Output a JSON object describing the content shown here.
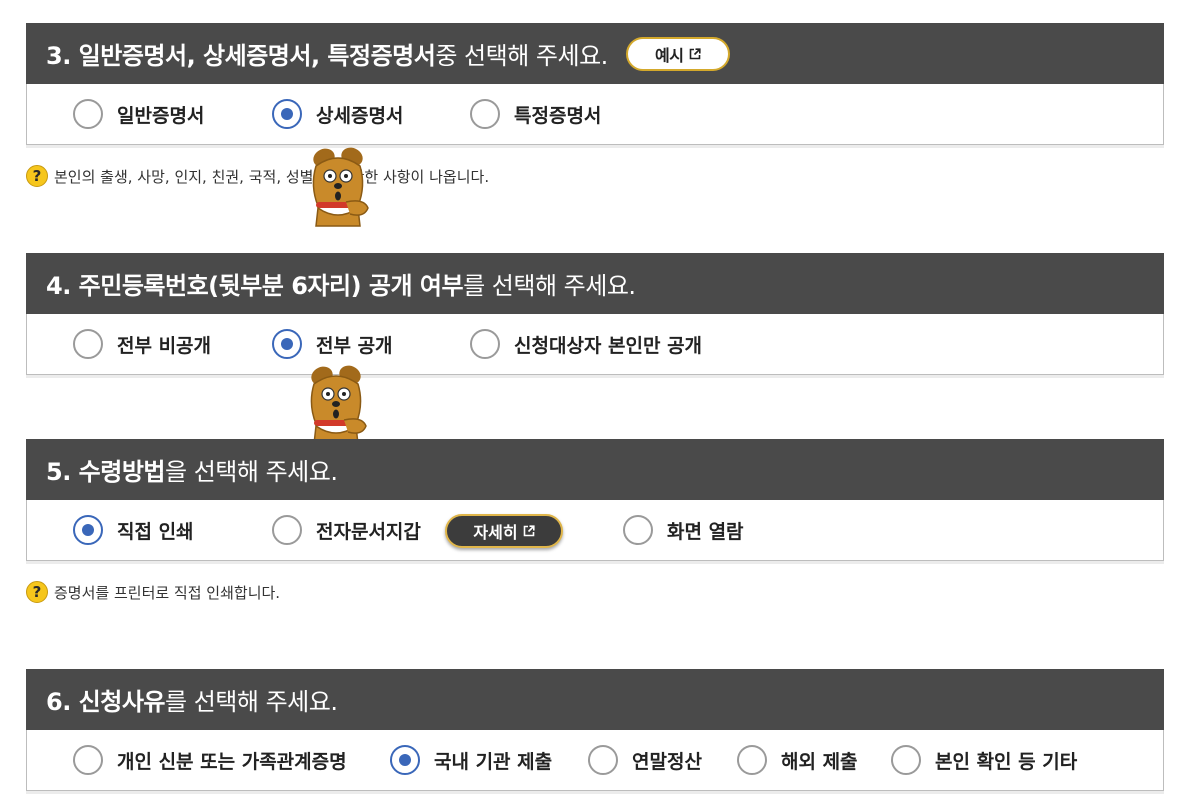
{
  "section3": {
    "title_bold": "3. 일반증명서, 상세증명서, 특정증명서",
    "title_normal": " 중 선택해 주세요.",
    "example_button": "예시",
    "options": [
      "일반증명서",
      "상세증명서",
      "특정증명서"
    ],
    "selected": "상세증명서",
    "hint": "본인의 출생, 사망, 인지, 친권, 국적, 성별 등에 관한 사항이 나옵니다."
  },
  "section4": {
    "title_bold": "4. 주민등록번호(뒷부분 6자리) 공개 여부",
    "title_normal": "를 선택해 주세요.",
    "options": [
      "전부 비공개",
      "전부 공개",
      "신청대상자 본인만 공개"
    ],
    "selected": "전부 공개"
  },
  "section5": {
    "title_bold": "5. 수령방법",
    "title_normal": "을 선택해 주세요.",
    "options": [
      "직접 인쇄",
      "전자문서지갑",
      "화면 열람"
    ],
    "detail_button": "자세히",
    "selected": "직접 인쇄",
    "hint": "증명서를 프린터로 직접 인쇄합니다."
  },
  "section6": {
    "title_bold": "6. 신청사유",
    "title_normal": "를 선택해 주세요.",
    "options": [
      "개인 신분 또는 가족관계증명",
      "국내 기관 제출",
      "연말정산",
      "해외 제출",
      "본인 확인 등 기타"
    ],
    "selected": "국내 기관 제출"
  },
  "icons": {
    "hint": "question-mark-icon",
    "external_link": "external-link-icon",
    "mascot": "dog-mascot-icon"
  },
  "colors": {
    "header_bg": "#4a4a4a",
    "radio_checked": "#3a67b9",
    "accent_gold": "#d4a92c",
    "hint_yellow": "#f6c61c"
  }
}
